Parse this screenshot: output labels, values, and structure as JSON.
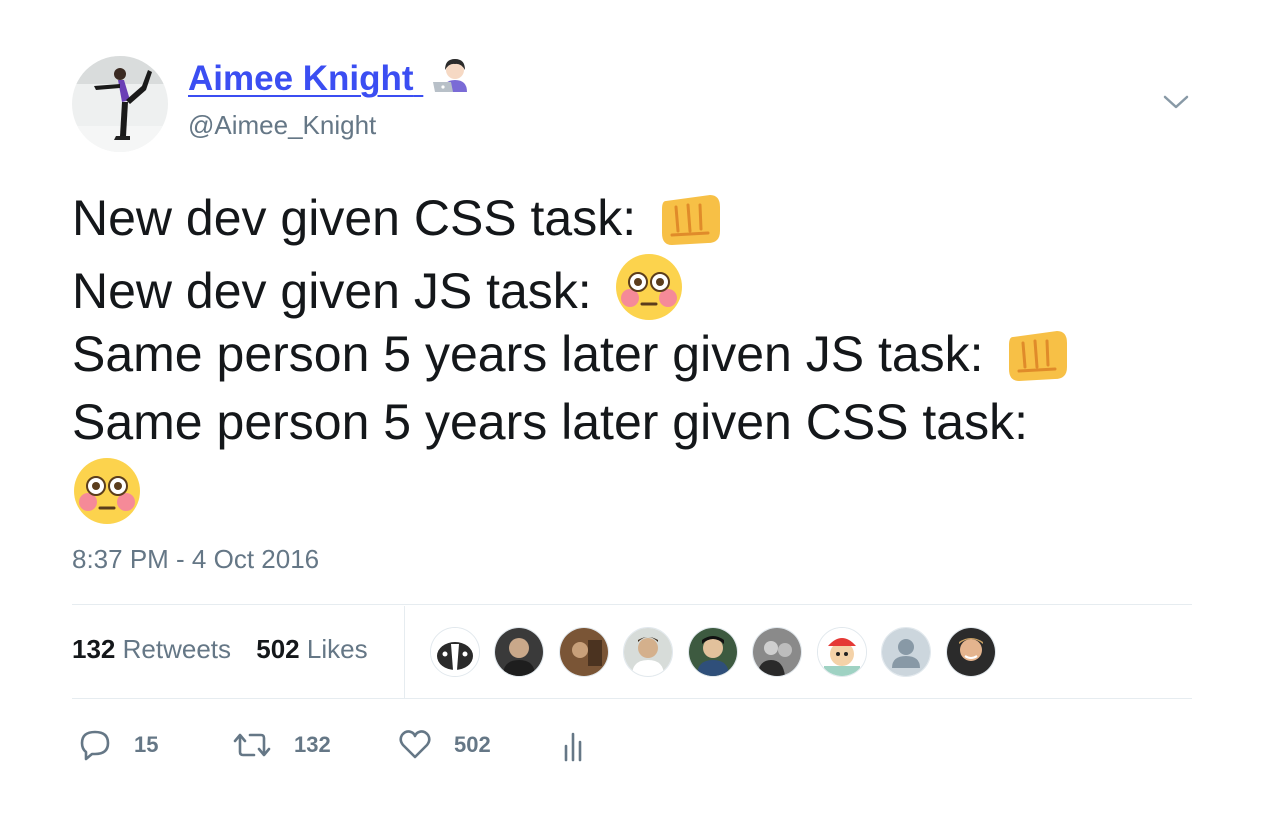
{
  "user": {
    "display_name": "Aimee Knight",
    "handle": "@Aimee_Knight",
    "avatar_icon": "figure-skater-avatar",
    "name_emoji_icon": "woman-technologist-emoji"
  },
  "tweet": {
    "lines": [
      {
        "text": "New dev given CSS task:",
        "emoji": "oncoming-fist-emoji"
      },
      {
        "text": "New dev given JS task:",
        "emoji": "flushed-face-emoji"
      },
      {
        "text": "Same person 5 years later given JS task:",
        "emoji": "oncoming-fist-emoji"
      },
      {
        "text": "Same person 5 years later given CSS task:",
        "emoji": ""
      },
      {
        "text": "",
        "emoji": "flushed-face-emoji"
      }
    ],
    "timestamp": "8:37 PM - 4 Oct 2016"
  },
  "stats": {
    "retweets_count": "132",
    "retweets_label": "Retweets",
    "likes_count": "502",
    "likes_label": "Likes"
  },
  "likers": [
    {
      "name": "liker-avatar-badger"
    },
    {
      "name": "liker-avatar-1"
    },
    {
      "name": "liker-avatar-2"
    },
    {
      "name": "liker-avatar-3"
    },
    {
      "name": "liker-avatar-4"
    },
    {
      "name": "liker-avatar-5"
    },
    {
      "name": "liker-avatar-cartoon"
    },
    {
      "name": "liker-avatar-default"
    },
    {
      "name": "liker-avatar-6"
    }
  ],
  "actions": {
    "reply_count": "15",
    "retweet_count": "132",
    "like_count": "502"
  },
  "colors": {
    "link_blue": "#3b4ef2",
    "muted_gray": "#657786",
    "divider": "#e6ecf0"
  }
}
